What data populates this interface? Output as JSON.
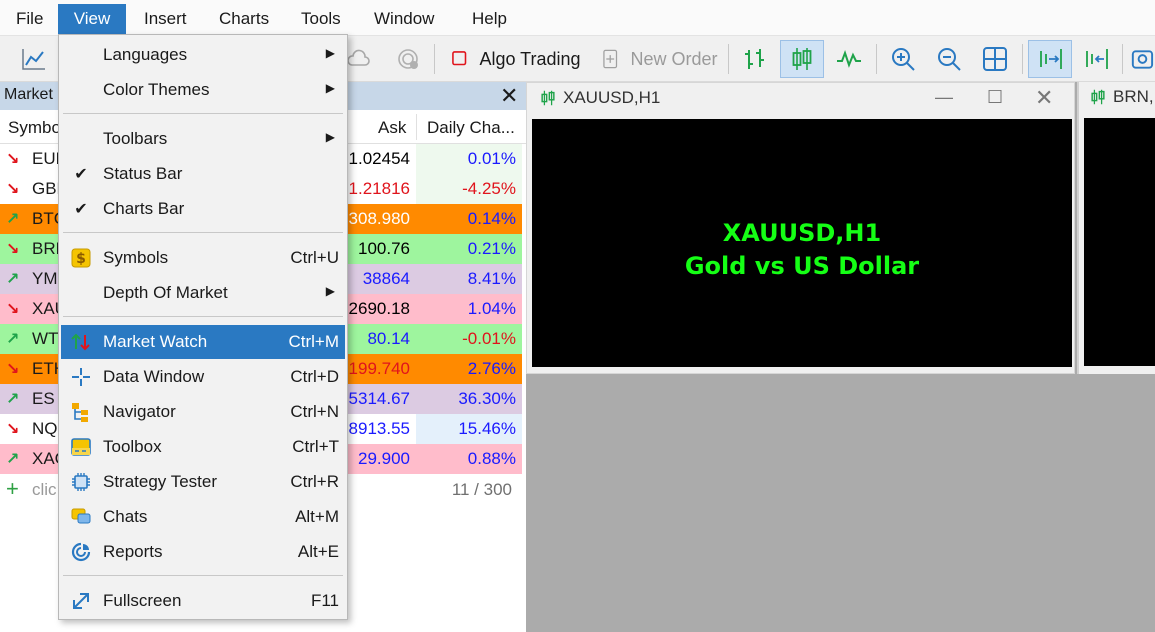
{
  "menubar": {
    "items": [
      "File",
      "View",
      "Insert",
      "Charts",
      "Tools",
      "Window",
      "Help"
    ],
    "active": "View"
  },
  "toolbar": {
    "algo_trading": "Algo Trading",
    "new_order": "New Order"
  },
  "market_watch": {
    "title": "Market",
    "columns": {
      "symbol": "Symbo",
      "ask": "Ask",
      "change": "Daily Cha..."
    },
    "rows": [
      {
        "symbol": "EUF",
        "ask": "1.02454",
        "change": "0.01%",
        "dir": "down",
        "ask_color": "#000000",
        "change_color": "#1a1aff",
        "bg": "#ffffff",
        "chg_bg": "#eef9ee"
      },
      {
        "symbol": "GBF",
        "ask": "1.21816",
        "change": "-4.25%",
        "dir": "down",
        "ask_color": "#e0141c",
        "change_color": "#e0141c",
        "bg": "#ffffff",
        "chg_bg": "#eef9ee"
      },
      {
        "symbol": "BTC",
        "ask": "308.980",
        "change": "0.14%",
        "dir": "up",
        "ask_color": "#ffffff",
        "change_color": "#1a1aff",
        "bg": "#ff8a00",
        "chg_bg": "#ff8a00"
      },
      {
        "symbol": "BRN",
        "ask": "100.76",
        "change": "0.21%",
        "dir": "down",
        "ask_color": "#000000",
        "change_color": "#1a1aff",
        "bg": "#9ef59e",
        "chg_bg": "#9ef59e"
      },
      {
        "symbol": "YM",
        "ask": "38864",
        "change": "8.41%",
        "dir": "up",
        "ask_color": "#1a1aff",
        "change_color": "#1a1aff",
        "bg": "#dccbe2",
        "chg_bg": "#dccbe2"
      },
      {
        "symbol": "XAU",
        "ask": "2690.18",
        "change": "1.04%",
        "dir": "down",
        "ask_color": "#000000",
        "change_color": "#1a1aff",
        "bg": "#ffbccb",
        "chg_bg": "#ffbccb"
      },
      {
        "symbol": "WT",
        "ask": "80.14",
        "change": "-0.01%",
        "dir": "up",
        "ask_color": "#1a1aff",
        "change_color": "#e0141c",
        "bg": "#9ef59e",
        "chg_bg": "#9ef59e"
      },
      {
        "symbol": "ETH",
        "ask": "199.740",
        "change": "2.76%",
        "dir": "down",
        "ask_color": "#e0141c",
        "change_color": "#1a1aff",
        "bg": "#ff8a00",
        "chg_bg": "#ff8a00"
      },
      {
        "symbol": "ES",
        "ask": "5314.67",
        "change": "36.30%",
        "dir": "up",
        "ask_color": "#1a1aff",
        "change_color": "#1a1aff",
        "bg": "#dccbe2",
        "chg_bg": "#dccbe2"
      },
      {
        "symbol": "NQ",
        "ask": "8913.55",
        "change": "15.46%",
        "dir": "down",
        "ask_color": "#1a1aff",
        "change_color": "#1a1aff",
        "bg": "#ffffff",
        "chg_bg": "#e4f0fb"
      },
      {
        "symbol": "XAC",
        "ask": "29.900",
        "change": "0.88%",
        "dir": "up",
        "ask_color": "#1a1aff",
        "change_color": "#1a1aff",
        "bg": "#ffbccb",
        "chg_bg": "#ffbccb"
      }
    ],
    "add_text": "clic",
    "count": "11 / 300"
  },
  "chart1": {
    "tab": "XAUUSD,H1",
    "line1": "XAUUSD,H1",
    "line2": "Gold vs US Dollar"
  },
  "chart2": {
    "tab": "BRN,"
  },
  "view_menu": {
    "items": [
      {
        "label": "Languages",
        "shortcut": "",
        "submenu": true,
        "icon": ""
      },
      {
        "label": "Color Themes",
        "shortcut": "",
        "submenu": true,
        "icon": ""
      },
      {
        "label": "Toolbars",
        "shortcut": "",
        "submenu": true,
        "icon": ""
      },
      {
        "label": "Status Bar",
        "shortcut": "",
        "submenu": false,
        "icon": "check-icon"
      },
      {
        "label": "Charts Bar",
        "shortcut": "",
        "submenu": false,
        "icon": "check-icon"
      },
      {
        "label": "Symbols",
        "shortcut": "Ctrl+U",
        "submenu": false,
        "icon": "dollar-icon"
      },
      {
        "label": "Depth Of Market",
        "shortcut": "",
        "submenu": true,
        "icon": ""
      },
      {
        "label": "Market Watch",
        "shortcut": "Ctrl+M",
        "submenu": false,
        "icon": "market-watch-icon"
      },
      {
        "label": "Data Window",
        "shortcut": "Ctrl+D",
        "submenu": false,
        "icon": "crosshair-icon"
      },
      {
        "label": "Navigator",
        "shortcut": "Ctrl+N",
        "submenu": false,
        "icon": "navigator-tree-icon"
      },
      {
        "label": "Toolbox",
        "shortcut": "Ctrl+T",
        "submenu": false,
        "icon": "toolbox-icon"
      },
      {
        "label": "Strategy Tester",
        "shortcut": "Ctrl+R",
        "submenu": false,
        "icon": "chip-icon"
      },
      {
        "label": "Chats",
        "shortcut": "Alt+M",
        "submenu": false,
        "icon": "chat-bubbles-icon"
      },
      {
        "label": "Reports",
        "shortcut": "Alt+E",
        "submenu": false,
        "icon": "reports-chart-icon"
      },
      {
        "label": "Fullscreen",
        "shortcut": "F11",
        "submenu": false,
        "icon": "fullscreen-arrow-icon"
      }
    ]
  },
  "colors": {
    "accent": "#2a79c2",
    "chart_text": "#15ff15"
  }
}
